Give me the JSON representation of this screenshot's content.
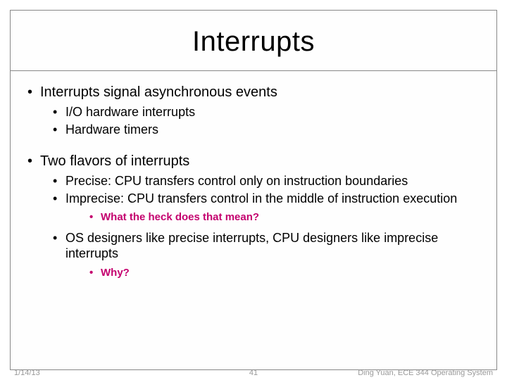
{
  "slide": {
    "title": "Interrupts",
    "bullets": {
      "b1": "Interrupts signal asynchronous events",
      "b1_1": "I/O hardware interrupts",
      "b1_2": "Hardware timers",
      "b2": "Two flavors of interrupts",
      "b2_1": "Precise: CPU transfers control only on instruction boundaries",
      "b2_2": "Imprecise: CPU transfers control in the middle of instruction execution",
      "b2_2_1": "What the heck does that mean?",
      "b2_3": "OS designers like precise interrupts, CPU designers like imprecise interrupts",
      "b2_3_1": "Why?"
    }
  },
  "footer": {
    "date": "1/14/13",
    "page": "41",
    "author": "Ding Yuan, ECE 344 Operating System"
  }
}
